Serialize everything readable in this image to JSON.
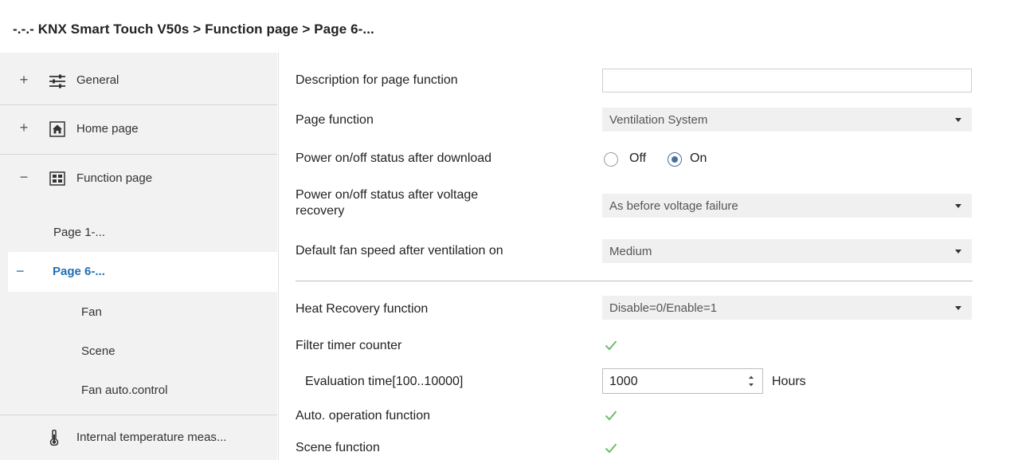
{
  "window": {
    "title": "-.-.- KNX Smart Touch V50s > Function page > Page 6-..."
  },
  "sidebar": {
    "items": [
      {
        "expander": "+",
        "icon": "sliders-icon",
        "label": "General"
      },
      {
        "expander": "+",
        "icon": "home-icon",
        "label": "Home page"
      },
      {
        "expander": "−",
        "icon": "grid-icon",
        "label": "Function page"
      }
    ],
    "pages": [
      {
        "label": "Page 1-..."
      },
      {
        "expander": "−",
        "label": "Page 6-...",
        "active": true
      }
    ],
    "subpages": [
      {
        "label": "Fan"
      },
      {
        "label": "Scene"
      },
      {
        "label": "Fan auto.control"
      }
    ],
    "bottom_item": {
      "icon": "thermometer-icon",
      "label": "Internal temperature meas..."
    }
  },
  "params": {
    "description": {
      "label": "Description for page function",
      "value": ""
    },
    "page_function": {
      "label": "Page function",
      "value": "Ventilation System"
    },
    "power_after_download": {
      "label": "Power on/off status after download",
      "options": [
        "Off",
        "On"
      ],
      "selected": "On"
    },
    "power_after_voltage": {
      "label_line1": "Power on/off status after voltage",
      "label_line2": "recovery",
      "value": "As before voltage failure"
    },
    "default_fan_speed": {
      "label": "Default fan speed after ventilation on",
      "value": "Medium"
    },
    "heat_recovery": {
      "label": "Heat Recovery function",
      "value": "Disable=0/Enable=1"
    },
    "filter_timer": {
      "label": "Filter timer counter",
      "checked": true
    },
    "evaluation_time": {
      "label": "Evaluation time[100..10000]",
      "value": "1000",
      "unit": "Hours"
    },
    "auto_operation": {
      "label": "Auto. operation function",
      "checked": true
    },
    "scene_function": {
      "label": "Scene function",
      "checked": true
    }
  },
  "colors": {
    "accent": "#1f6fb5",
    "sidebar_bg": "#f2f2f2",
    "dropdown_bg": "#f0f0f0",
    "check": "#6dbb6d"
  }
}
